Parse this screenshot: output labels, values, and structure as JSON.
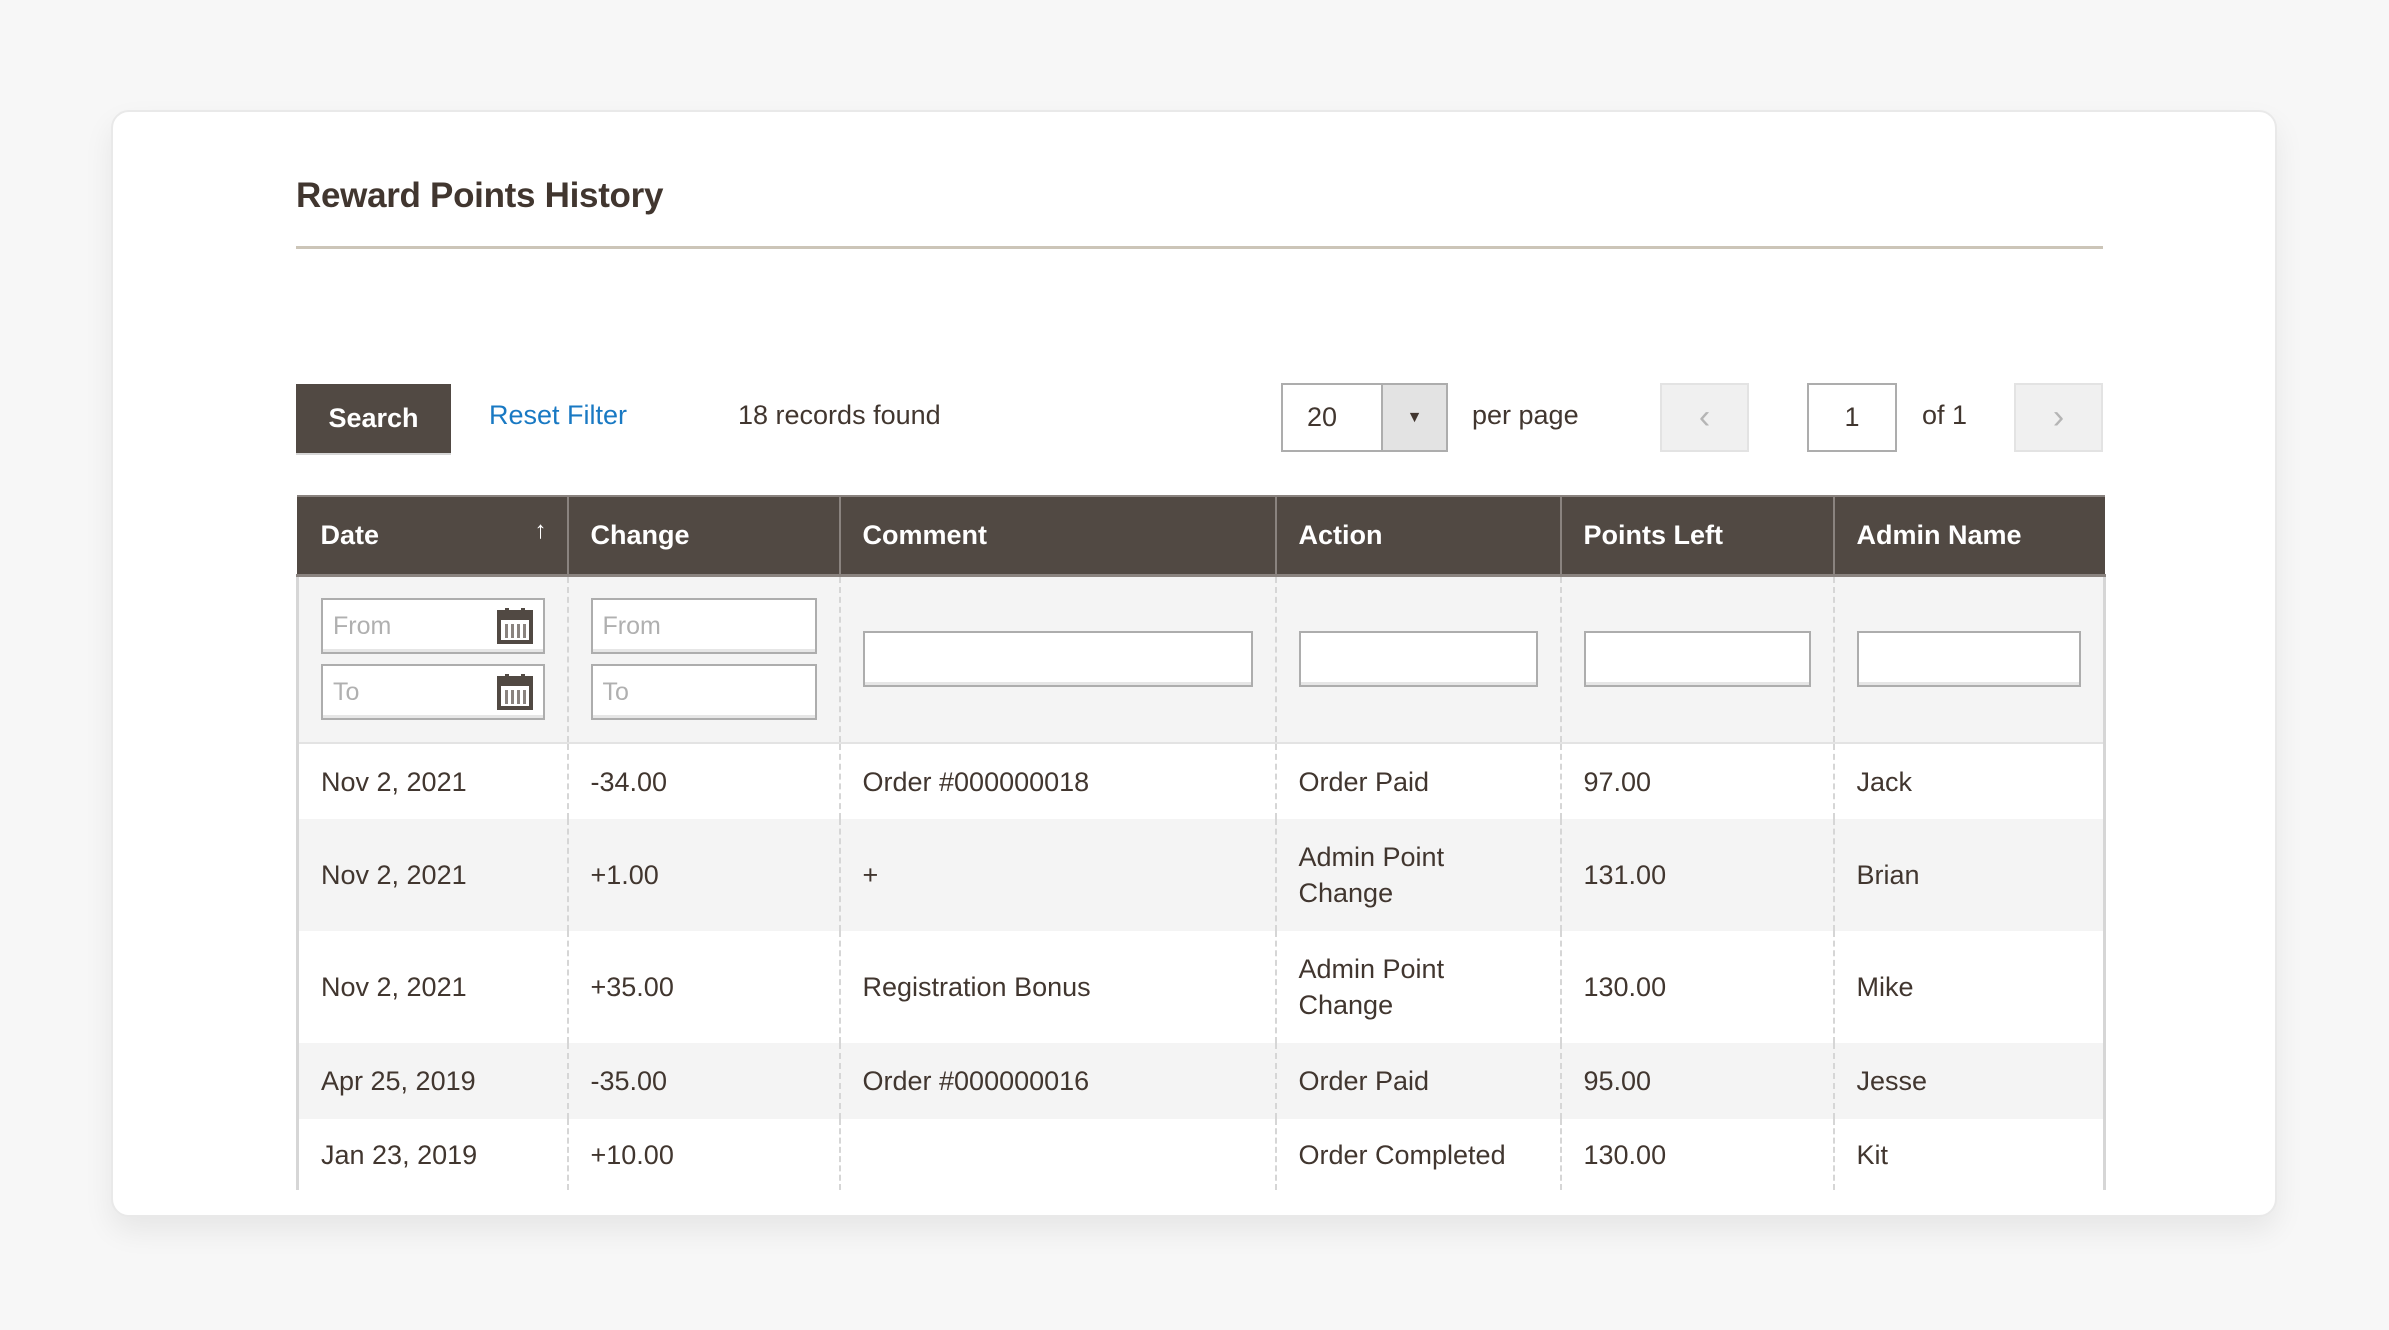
{
  "page": {
    "title": "Reward Points History"
  },
  "toolbar": {
    "search_label": "Search",
    "reset_label": "Reset Filter",
    "records_found": "18 records found",
    "per_page_value": "20",
    "per_page_label": "per page",
    "prev_icon": "‹",
    "next_icon": "›",
    "current_page": "1",
    "page_of": "of 1"
  },
  "colors": {
    "header_bg": "#514943",
    "link": "#1979c3",
    "text": "#41362f",
    "stripe": "#f4f4f4"
  },
  "table": {
    "columns": [
      {
        "label": "Date",
        "sorted": "asc",
        "sort_icon": "↑"
      },
      {
        "label": "Change"
      },
      {
        "label": "Comment"
      },
      {
        "label": "Action"
      },
      {
        "label": "Points Left"
      },
      {
        "label": "Admin Name"
      }
    ],
    "filters": {
      "date_from_placeholder": "From",
      "date_to_placeholder": "To",
      "change_from_placeholder": "From",
      "change_to_placeholder": "To",
      "comment_value": "",
      "action_value": "",
      "points_left_value": "",
      "admin_name_value": ""
    },
    "rows": [
      {
        "date": "Nov 2, 2021",
        "change": "-34.00",
        "comment": "Order #000000018",
        "action": "Order Paid",
        "points_left": "97.00",
        "admin_name": "Jack"
      },
      {
        "date": "Nov 2, 2021",
        "change": "+1.00",
        "comment": "+",
        "action": "Admin Point Change",
        "points_left": "131.00",
        "admin_name": "Brian"
      },
      {
        "date": "Nov 2, 2021",
        "change": "+35.00",
        "comment": "Registration Bonus",
        "action": "Admin Point Change",
        "points_left": "130.00",
        "admin_name": "Mike"
      },
      {
        "date": "Apr 25, 2019",
        "change": "-35.00",
        "comment": "Order #000000016",
        "action": "Order Paid",
        "points_left": "95.00",
        "admin_name": "Jesse"
      },
      {
        "date": "Jan 23, 2019",
        "change": "+10.00",
        "comment": "",
        "action": "Order Completed",
        "points_left": "130.00",
        "admin_name": "Kit"
      }
    ]
  }
}
